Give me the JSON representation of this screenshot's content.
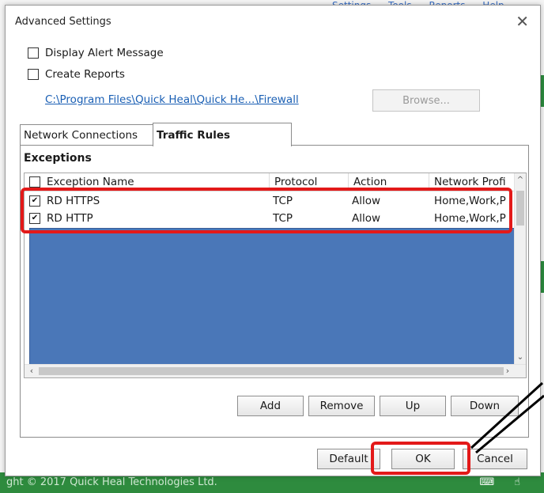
{
  "background": {
    "menu": [
      "Settings",
      "Tools",
      "Reports",
      "Help"
    ],
    "copyright": "ght © 2017 Quick Heal Technologies Ltd."
  },
  "dialog": {
    "title": "Advanced Settings",
    "close_icon": "close-icon",
    "display_alert_label": "Display Alert Message",
    "create_reports_label": "Create Reports",
    "path_link": "C:\\Program Files\\Quick Heal\\Quick He...\\Firewall",
    "browse_label": "Browse..."
  },
  "tabs": [
    {
      "label": "Network Connections",
      "active": false
    },
    {
      "label": "Traffic Rules",
      "active": true
    }
  ],
  "exceptions": {
    "title": "Exceptions",
    "columns": [
      "Exception Name",
      "Protocol",
      "Action",
      "Network Profi"
    ],
    "rows": [
      {
        "checked": true,
        "name": "RD HTTPS",
        "protocol": "TCP",
        "action": "Allow",
        "network": "Home,Work,P"
      },
      {
        "checked": true,
        "name": "RD HTTP",
        "protocol": "TCP",
        "action": "Allow",
        "network": "Home,Work,P"
      }
    ]
  },
  "panel_buttons": {
    "add": "Add",
    "remove": "Remove",
    "up": "Up",
    "down": "Down"
  },
  "dialog_buttons": {
    "default": "Default",
    "ok": "OK",
    "cancel": "Cancel"
  },
  "colors": {
    "highlight": "#e31919",
    "selection_blue": "#4a77b8",
    "link": "#1a5fb4",
    "footer_green": "#2e8b3e"
  }
}
